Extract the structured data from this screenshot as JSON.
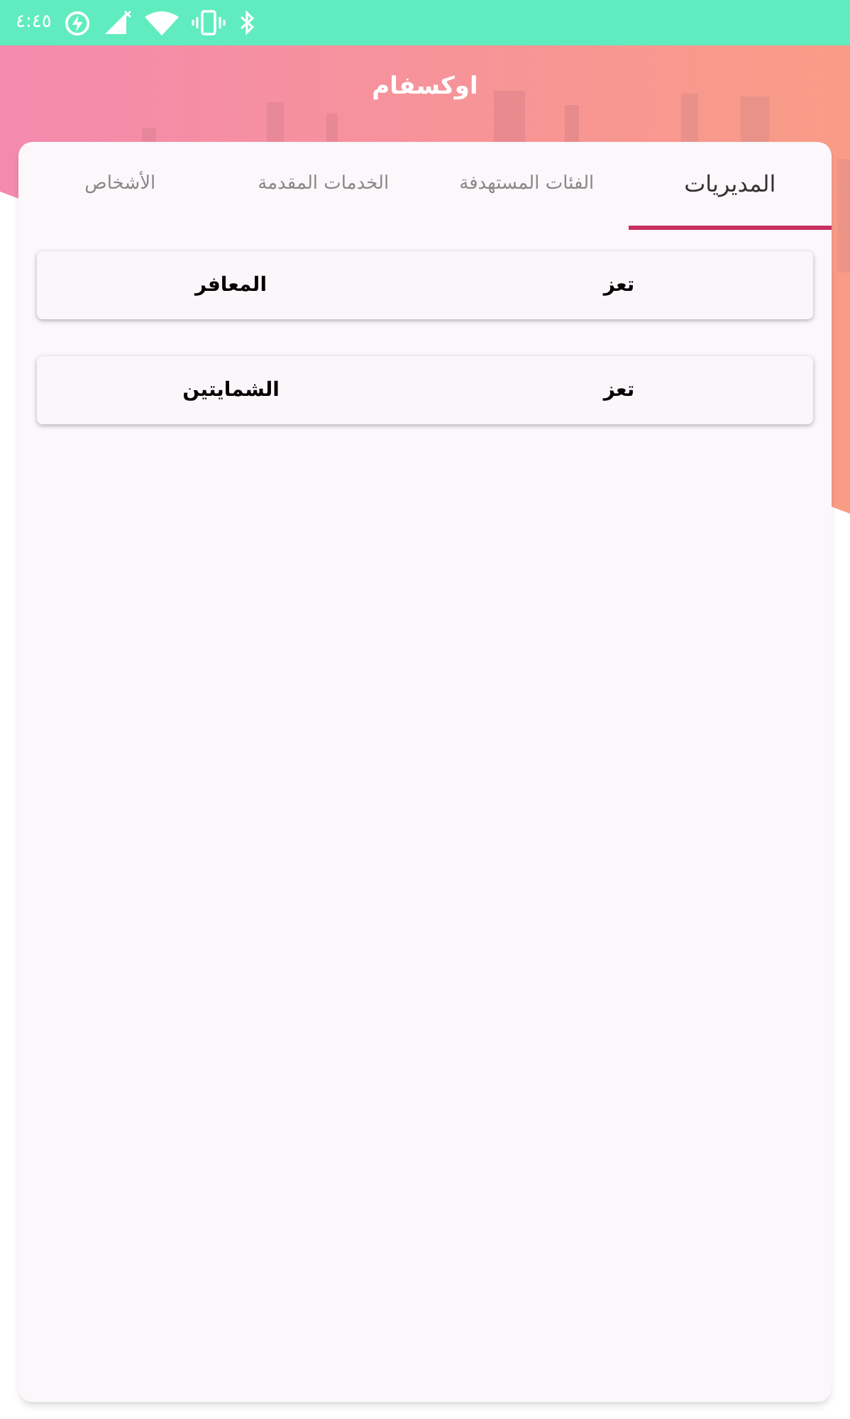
{
  "status_bar": {
    "time": "٤:٤٥"
  },
  "title": "اوكسفام",
  "tabs": [
    {
      "label": "المديريات",
      "selected": true
    },
    {
      "label": "الفئات المستهدفة",
      "selected": false
    },
    {
      "label": "الخدمات المقدمة",
      "selected": false
    },
    {
      "label": "الأشخاص",
      "selected": false
    }
  ],
  "rows": [
    {
      "column_1": "تعز",
      "column_2": "المعافر"
    },
    {
      "column_1": "تعز",
      "column_2": "الشمايتين"
    }
  ]
}
